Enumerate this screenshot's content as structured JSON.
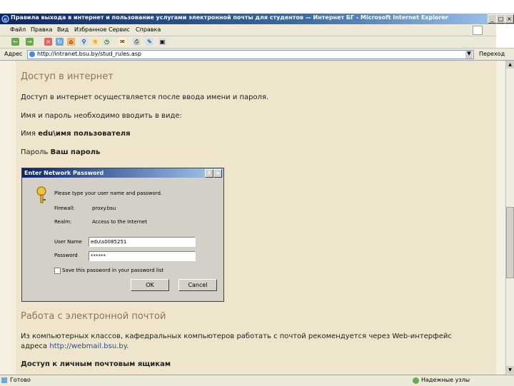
{
  "window": {
    "title": "Правила выхода в интернет и пользование услугами электронной почты для студентов — Интернет БГ - Microsoft Internet Explorer",
    "minimize": "_",
    "maximize": "□",
    "close": "×"
  },
  "menubar": {
    "items": [
      "Файл",
      "Правка",
      "Вид",
      "Избранное",
      "Сервис",
      "Справка"
    ]
  },
  "toolbar": {
    "back": "←",
    "forward": "→",
    "stop": "×",
    "refresh": "↻",
    "home": "⌂",
    "search": "⚲",
    "favorites": "☆",
    "history": "◷",
    "mail": "✉",
    "print": "⎙",
    "edit": "✎",
    "discuss": "▣"
  },
  "addressbar": {
    "label": "Адрес",
    "url": "http://intranet.bsu.by/stud_rules.asp",
    "go_label": "Переход"
  },
  "content": {
    "heading1": "Доступ в интернет",
    "para1": "Доступ в интернет осуществляется после ввода имени и пароля.",
    "para2": "Имя и пароль необходимо вводить в виде:",
    "name_line_prefix": "Имя ",
    "name_line_value": "edu\\имя пользователя",
    "pass_line_prefix": "Пароль ",
    "pass_line_value": "Ваш пароль",
    "heading2": "Работа с электронной почтой",
    "para3": "Из компьютерных классов, кафедральных компьютеров работать с почтой рекомендуется через Web-интерфейс",
    "para4_prefix": "адреса ",
    "para4_link": "http://webmail.bsu.by",
    "para4_suffix": ".",
    "heading3": "Доступ к личным почтовым ящикам"
  },
  "dialog": {
    "title": "Enter Network Password",
    "help_btn": "?",
    "close_btn": "×",
    "prompt": "Please type your user name and password.",
    "firewall_label": "Firewall:",
    "firewall_value": "proxy.bsu",
    "realm_label": "Realm:",
    "realm_value": "Access to the Internet",
    "username_label": "User Name",
    "username_value": "edu\\s0085251",
    "password_label": "Password",
    "password_value": "******",
    "save_label": "Save this password in your password list",
    "ok_label": "OK",
    "cancel_label": "Cancel"
  },
  "status": {
    "text": "Готово",
    "zone": "Надежные узлы"
  }
}
